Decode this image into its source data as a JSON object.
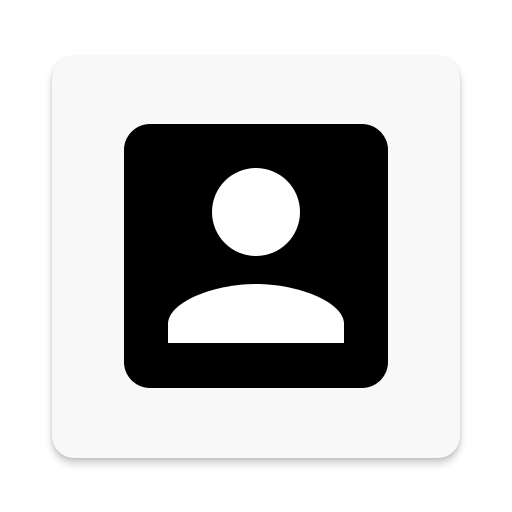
{
  "icon": {
    "name": "contact-profile-icon",
    "foreground": "#000000",
    "tile_background": "#f8f8f8",
    "page_background": "#ffffff"
  }
}
